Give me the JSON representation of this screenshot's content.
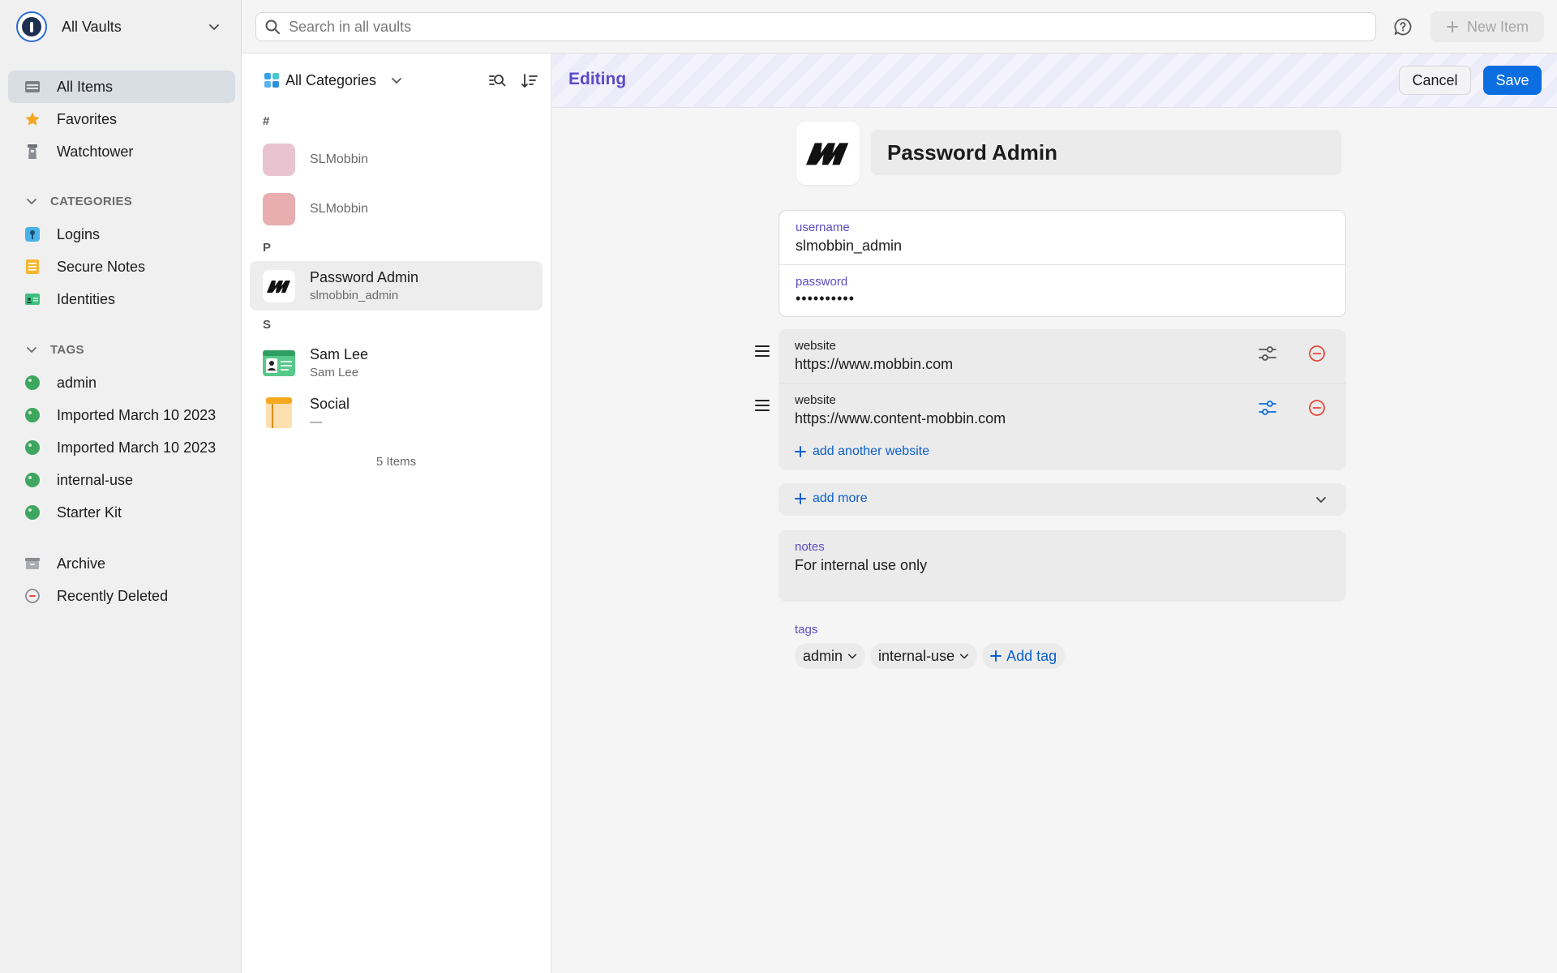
{
  "vault": {
    "name": "All Vaults"
  },
  "sidebar": {
    "main_items": [
      {
        "label": "All Items"
      },
      {
        "label": "Favorites"
      },
      {
        "label": "Watchtower"
      }
    ],
    "categories_heading": "CATEGORIES",
    "categories": [
      {
        "label": "Logins"
      },
      {
        "label": "Secure Notes"
      },
      {
        "label": "Identities"
      }
    ],
    "tags_heading": "TAGS",
    "tags": [
      {
        "label": "admin"
      },
      {
        "label": "Imported March 10 2023"
      },
      {
        "label": "Imported March 10 2023"
      },
      {
        "label": "internal-use"
      },
      {
        "label": "Starter Kit"
      }
    ],
    "bottom_items": [
      {
        "label": "Archive"
      },
      {
        "label": "Recently Deleted"
      }
    ]
  },
  "topbar": {
    "search_placeholder": "Search in all vaults",
    "new_item_label": "New Item"
  },
  "list": {
    "filter_label": "All Categories",
    "groups": [
      {
        "letter": "#",
        "items": [
          {
            "title": "SLMobbin"
          },
          {
            "title": "SLMobbin"
          }
        ]
      },
      {
        "letter": "P",
        "items": [
          {
            "title": "Password Admin",
            "subtitle": "slmobbin_admin"
          }
        ]
      },
      {
        "letter": "S",
        "items": [
          {
            "title": "Sam Lee",
            "subtitle": "Sam Lee"
          },
          {
            "title": "Social",
            "subtitle": "—"
          }
        ]
      }
    ],
    "count_label": "5 Items"
  },
  "editor": {
    "mode_label": "Editing",
    "cancel_label": "Cancel",
    "save_label": "Save",
    "title": "Password Admin",
    "username_label": "username",
    "username_value": "slmobbin_admin",
    "password_label": "password",
    "password_value": "••••••••••",
    "websites": [
      {
        "label": "website",
        "value": "https://www.mobbin.com"
      },
      {
        "label": "website",
        "value": "https://www.content-mobbin.com"
      }
    ],
    "add_website_label": "add another website",
    "add_more_label": "add more",
    "notes_label": "notes",
    "notes_value": "For internal use only",
    "tags_label": "tags",
    "tags": [
      "admin",
      "internal-use"
    ],
    "add_tag_label": "Add tag"
  },
  "colors": {
    "accent": "#0b6ee0",
    "editing": "#5b4cc4",
    "danger": "#e5483d",
    "tag": "#3ea65f"
  }
}
